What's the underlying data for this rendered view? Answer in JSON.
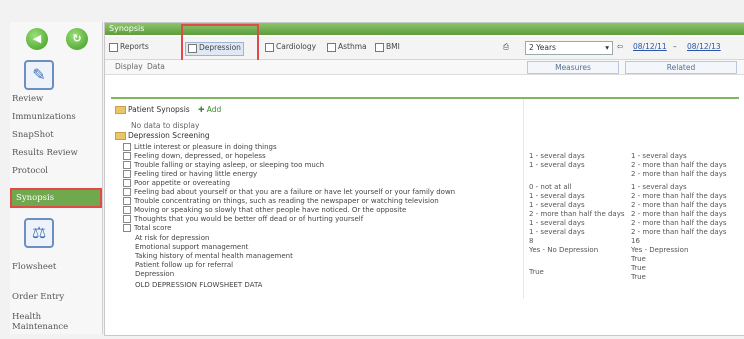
{
  "nav": {
    "back_icon": "back-arrow-icon",
    "refresh_icon": "refresh-icon",
    "review_label": "Review",
    "items": [
      "Immunizations",
      "SnapShot",
      "Results Review",
      "Protocol",
      "Synopsis"
    ],
    "flowsheet_label": "Flowsheet",
    "bottom_items": [
      "Order Entry",
      "Health Maintenance"
    ]
  },
  "window": {
    "title": "Synopsis"
  },
  "toolbar": {
    "buttons": [
      "Reports",
      "Depression",
      "Cardiology",
      "Asthma",
      "BMI"
    ],
    "range_value": "2 Years",
    "date_from": "08/12/11",
    "date_to": "08/12/13"
  },
  "subbar": {
    "tabs": [
      "Display",
      "Data"
    ],
    "col1": "Measures",
    "col2": "Related"
  },
  "content": {
    "patient_synopsis": "Patient Synopsis",
    "add": "Add",
    "no_data": "No data to display",
    "screening_title": "Depression Screening",
    "questions": [
      "Little interest or pleasure in doing things",
      "Feeling down, depressed, or hopeless",
      "Trouble falling or staying asleep, or sleeping too much",
      "Feeling tired or having little energy",
      "Poor appetite or overeating",
      "Feeling bad about yourself or that you are a failure or have let yourself or your family down",
      "Trouble concentrating on things, such as reading the newspaper or watching television",
      "Moving or speaking so slowly that other people have noticed. Or the opposite",
      "Thoughts that you would be better off dead or of hurting yourself",
      "Total score"
    ],
    "followups": [
      "At risk for depression",
      "Emotional support management",
      "Taking history of mental health management",
      "Patient follow up for referral",
      "Depression",
      "OLD DEPRESSION FLOWSHEET DATA"
    ],
    "values_a": [
      "1 - several days",
      "1 - several days",
      "",
      "0 - not at all",
      "1 - several days",
      "1 - several days",
      "2 - more than half the days",
      "1 - several days",
      "1 - several days",
      "8",
      "Yes - No Depression",
      "",
      "True"
    ],
    "values_b": [
      "1 - several days",
      "2 - more than half the days",
      "2 - more than half the days",
      "1 - several days",
      "2 - more than half the days",
      "2 - more than half the days",
      "2 - more than half the days",
      "2 - more than half the days",
      "2 - more than half the days",
      "16",
      "Yes - Depression",
      "True",
      "True",
      "True"
    ]
  }
}
